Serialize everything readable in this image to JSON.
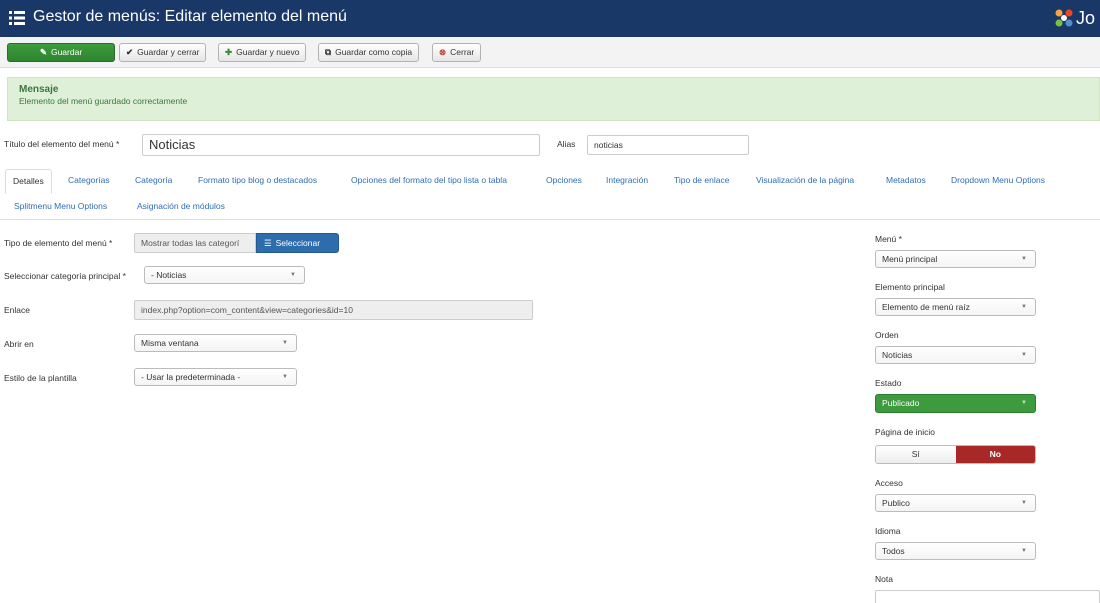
{
  "header": {
    "title": "Gestor de menús: Editar elemento del menú",
    "logo_text": "Jo"
  },
  "toolbar": {
    "save": "Guardar",
    "save_close": "Guardar y cerrar",
    "save_new": "Guardar y nuevo",
    "save_copy": "Guardar como copia",
    "close": "Cerrar"
  },
  "message": {
    "heading": "Mensaje",
    "text": "Elemento del menú guardado correctamente"
  },
  "form": {
    "title_label": "Título del elemento del menú *",
    "title_value": "Noticias",
    "alias_label": "Alias",
    "alias_value": "noticias"
  },
  "tabs": [
    "Detalles",
    "Categorías",
    "Categoría",
    "Formato tipo blog o destacados",
    "Opciones del formato del tipo lista o tabla",
    "Opciones",
    "Integración",
    "Tipo de enlace",
    "Visualización de la página",
    "Metadatos",
    "Dropdown Menu Options",
    "Splitmenu Menu Options",
    "Asignación de módulos"
  ],
  "details": {
    "type_label": "Tipo de elemento del menú *",
    "type_value": "Mostrar todas las categorí",
    "select_button": "Seleccionar",
    "parent_cat_label": "Seleccionar categoría principal *",
    "parent_cat_value": "- Noticias",
    "link_label": "Enlace",
    "link_value": "index.php?option=com_content&view=categories&id=10",
    "open_label": "Abrir en",
    "open_value": "Misma ventana",
    "style_label": "Estilo de la plantilla",
    "style_value": "- Usar la predeterminada -"
  },
  "sidebar": {
    "menu_label": "Menú *",
    "menu_value": "Menú principal",
    "parent_label": "Elemento principal",
    "parent_value": "Elemento de menú raíz",
    "order_label": "Orden",
    "order_value": "Noticias",
    "state_label": "Estado",
    "state_value": "Publicado",
    "home_label": "Página de inicio",
    "home_yes": "Sí",
    "home_no": "No",
    "access_label": "Acceso",
    "access_value": "Publico",
    "language_label": "Idioma",
    "language_value": "Todos",
    "note_label": "Nota"
  },
  "colors": {
    "header_bg": "#1a3867",
    "save_green": "#2f842f",
    "published_green": "#3d9a3d",
    "no_red": "#a82828",
    "link_blue": "#2f6db5",
    "message_bg": "#dff0d8"
  }
}
